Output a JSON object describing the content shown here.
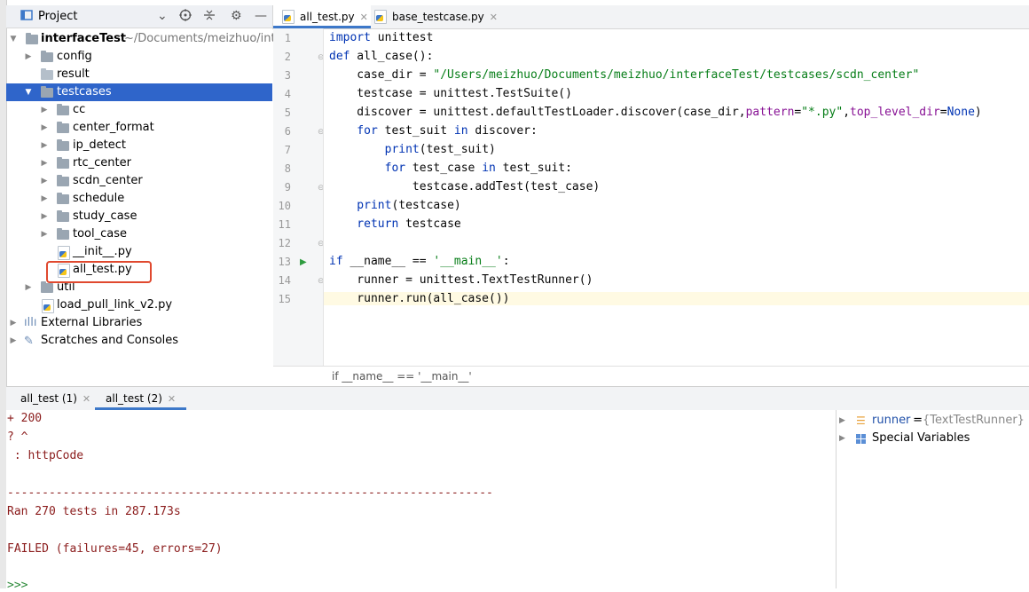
{
  "project_panel": {
    "title": "Project"
  },
  "tree": {
    "root_name": "interfaceTest",
    "root_path": "~/Documents/meizhuo/inter",
    "items": [
      {
        "label": "config"
      },
      {
        "label": "result"
      },
      {
        "label": "testcases"
      },
      {
        "label": "cc"
      },
      {
        "label": "center_format"
      },
      {
        "label": "ip_detect"
      },
      {
        "label": "rtc_center"
      },
      {
        "label": "scdn_center"
      },
      {
        "label": "schedule"
      },
      {
        "label": "study_case"
      },
      {
        "label": "tool_case"
      },
      {
        "label": "__init__.py"
      },
      {
        "label": "all_test.py"
      },
      {
        "label": "util"
      },
      {
        "label": "load_pull_link_v2.py"
      },
      {
        "label": "External Libraries"
      },
      {
        "label": "Scratches and Consoles"
      }
    ]
  },
  "editor": {
    "tabs": [
      {
        "label": "all_test.py"
      },
      {
        "label": "base_testcase.py"
      }
    ],
    "line_numbers": [
      "1",
      "2",
      "3",
      "4",
      "5",
      "6",
      "7",
      "8",
      "9",
      "10",
      "11",
      "12",
      "13",
      "14",
      "15"
    ],
    "breadcrumb": "if __name__ == '__main__'"
  },
  "code": {
    "l1_kw": "import",
    "l1_rest": " unittest",
    "l2_kw": "def",
    "l2_rest": " all_case():",
    "l3_a": "    case_dir = ",
    "l3_str": "\"/Users/meizhuo/Documents/meizhuo/interfaceTest/testcases/scdn_center\"",
    "l4": "    testcase = unittest.TestSuite()",
    "l5_a": "    discover = unittest.defaultTestLoader.discover(case_dir,",
    "l5_k1": "pattern",
    "l5_eq1": "=",
    "l5_s": "\"*.py\"",
    "l5_c": ",",
    "l5_k2": "top_level_dir",
    "l5_eq2": "=",
    "l5_none": "None",
    "l5_end": ")",
    "l6_kw": "    for",
    "l6_a": " test_suit ",
    "l6_in": "in",
    "l6_b": " discover:",
    "l7_fn": "        print",
    "l7_rest": "(test_suit)",
    "l8_kw": "        for",
    "l8_a": " test_case ",
    "l8_in": "in",
    "l8_b": " test_suit:",
    "l9": "            testcase.addTest(test_case)",
    "l10_fn": "    print",
    "l10_rest": "(testcase)",
    "l11_kw": "    return",
    "l11_rest": " testcase",
    "l13_kw": "if",
    "l13_a": " __name__ == ",
    "l13_str": "'__main__'",
    "l13_b": ":",
    "l14": "    runner = unittest.TextTestRunner()",
    "l15": "    runner.run(all_case())"
  },
  "run_panel": {
    "tabs": [
      {
        "label": "all_test (1)"
      },
      {
        "label": "all_test (2)"
      }
    ],
    "console_lines": [
      "+ 200",
      "? ^",
      " : httpCode",
      "----------------------------------------------------------------------",
      "Ran 270 tests in 287.173s",
      "FAILED (failures=45, errors=27)",
      ">>>"
    ],
    "variables": [
      {
        "name": "runner",
        "eq": " = ",
        "value": "{TextTestRunner} <u"
      },
      {
        "name": "Special Variables"
      }
    ]
  },
  "colors": {
    "selection": "#2f65ca",
    "highlight_box": "#e0492f",
    "keyword": "#0033b3",
    "string": "#067d17",
    "console_text": "#8b1c1c"
  },
  "icons": [
    "project-icon",
    "chevron-down-icon",
    "target-icon",
    "collapse-icon",
    "gear-icon",
    "minimize-icon",
    "folder-icon",
    "python-file-icon",
    "library-icon",
    "scratches-icon",
    "run-icon",
    "close-icon",
    "list-icon",
    "variables-grid-icon"
  ]
}
